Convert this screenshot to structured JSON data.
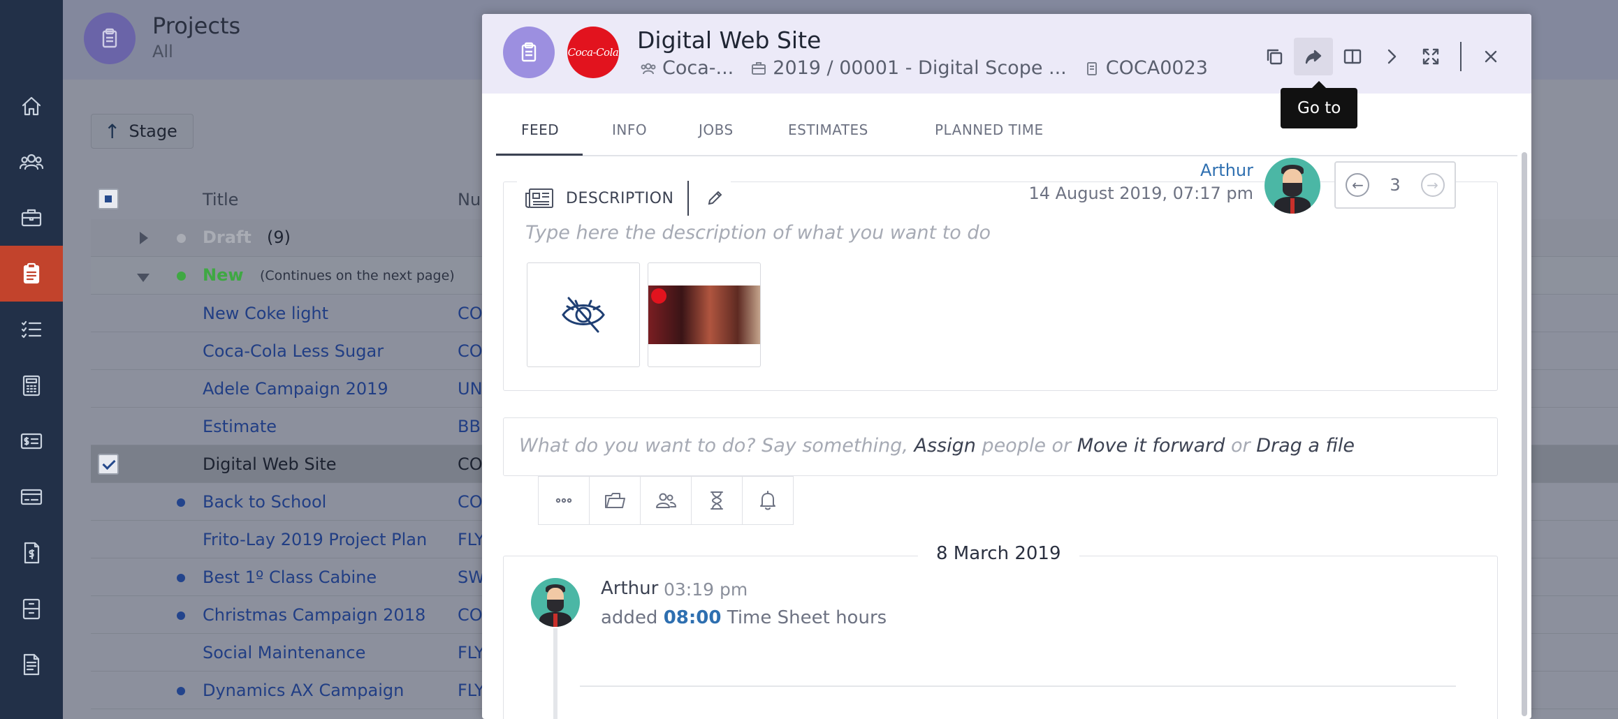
{
  "nav": {
    "items": [
      {
        "name": "home",
        "icon": "home-icon"
      },
      {
        "name": "people",
        "icon": "people-icon"
      },
      {
        "name": "clients",
        "icon": "briefcase-icon"
      },
      {
        "name": "projects",
        "icon": "clipboard-icon",
        "active": true
      },
      {
        "name": "tasks",
        "icon": "checklist-icon"
      },
      {
        "name": "calculator",
        "icon": "calculator-icon"
      },
      {
        "name": "billing",
        "icon": "money-card-icon"
      },
      {
        "name": "payments",
        "icon": "card-icon"
      },
      {
        "name": "invoices",
        "icon": "invoice-icon"
      },
      {
        "name": "archive",
        "icon": "archive-icon"
      },
      {
        "name": "documents",
        "icon": "document-icon"
      }
    ]
  },
  "page": {
    "title": "Projects",
    "subtitle": "All",
    "stage_label": "Stage",
    "columns": {
      "title": "Title",
      "number": "Nu"
    },
    "groups": {
      "draft": {
        "name": "Draft",
        "count": "(9)",
        "color": "#a9acb4"
      },
      "new": {
        "name": "New",
        "note": "(Continues on the next page)",
        "color": "#3fa843"
      }
    },
    "rows": [
      {
        "title": "New Coke light",
        "num": "CO",
        "dot": false
      },
      {
        "title": "Coca-Cola Less Sugar",
        "num": "CO",
        "dot": false
      },
      {
        "title": "Adele Campaign 2019",
        "num": "UN",
        "dot": false
      },
      {
        "title": "Estimate",
        "num": "BB",
        "dot": false
      },
      {
        "title": "Digital Web Site",
        "num": "CO",
        "dot": false,
        "selected": true
      },
      {
        "title": "Back to School",
        "num": "CO",
        "dot": true
      },
      {
        "title": "Frito-Lay 2019 Project Plan",
        "num": "FLY",
        "dot": false
      },
      {
        "title": "Best 1º Class Cabine",
        "num": "SW",
        "dot": true
      },
      {
        "title": "Christmas Campaign 2018",
        "num": "CO",
        "dot": true
      },
      {
        "title": "Social Maintenance",
        "num": "FLY",
        "dot": false
      },
      {
        "title": "Dynamics AX Campaign",
        "num": "FLY",
        "dot": true
      }
    ]
  },
  "modal": {
    "title": "Digital Web Site",
    "client_logo_text": "Coca-Cola",
    "meta": {
      "client": "Coca-...",
      "estimate": "2019 / 00001 - Digital Scope ...",
      "code": "COCA0023"
    },
    "tooltip": "Go to",
    "tabs": [
      "FEED",
      "INFO",
      "JOBS",
      "ESTIMATES",
      "PLANNED TIME"
    ],
    "description": {
      "label": "DESCRIPTION",
      "author": "Arthur",
      "date": "14 August 2019, 07:17 pm",
      "version": "3",
      "placeholder": "Type here the description of what you want to do"
    },
    "composer": {
      "p1": "What do you want to do? Say something, ",
      "assign": "Assign",
      "p2": " people or ",
      "move": "Move it forward",
      "p3": " or ",
      "drag": "Drag a file"
    },
    "feed": {
      "date": "8 March 2019",
      "user": "Arthur",
      "time": "03:19 pm",
      "action": "added",
      "hours": "08:00",
      "suffix": "Time Sheet hours"
    }
  }
}
